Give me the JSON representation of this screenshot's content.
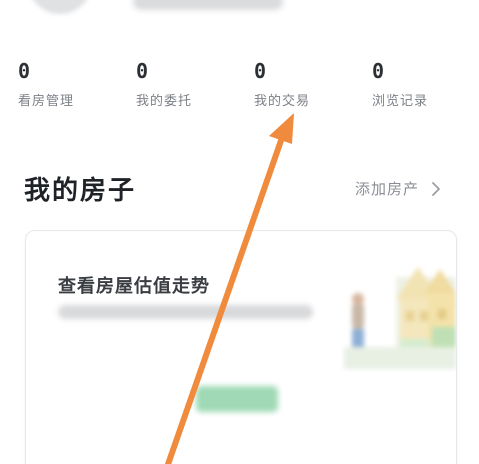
{
  "stats": [
    {
      "value": "0",
      "label": "看房管理"
    },
    {
      "value": "0",
      "label": "我的委托"
    },
    {
      "value": "0",
      "label": "我的交易"
    },
    {
      "value": "0",
      "label": "浏览记录"
    }
  ],
  "my_house": {
    "title": "我的房子",
    "add_label": "添加房产",
    "card": {
      "title": "查看房屋估值走势"
    }
  },
  "colors": {
    "arrow": "#f08a3c",
    "button_green": "#9fd9b5"
  },
  "icons": {
    "add_chevron": "chevron-right-icon"
  }
}
